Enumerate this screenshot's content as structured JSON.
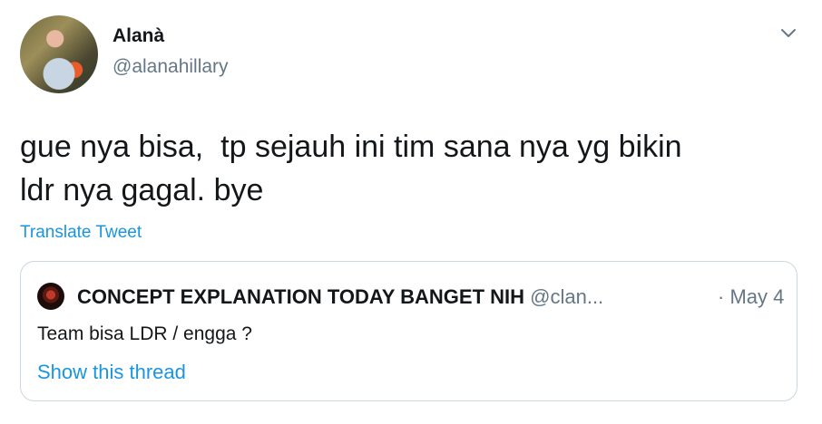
{
  "tweet": {
    "author_name": "Alanà",
    "author_handle": "@alanahillary",
    "text": "gue nya bisa,  tp sejauh ini tim sana nya yg bikin\nldr nya gagal. bye",
    "translate_label": "Translate Tweet",
    "menu_icon": "chevron-down-icon"
  },
  "quoted_tweet": {
    "author_name": "CONCEPT EXPLANATION TODAY BANGET NIH",
    "author_handle": "@clan...",
    "date": "· May 4",
    "text": "Team bisa LDR / engga ?",
    "show_thread_label": "Show this thread"
  },
  "colors": {
    "link": "#1b95e0",
    "secondary_text": "#657786",
    "border": "#ccd6dd"
  }
}
